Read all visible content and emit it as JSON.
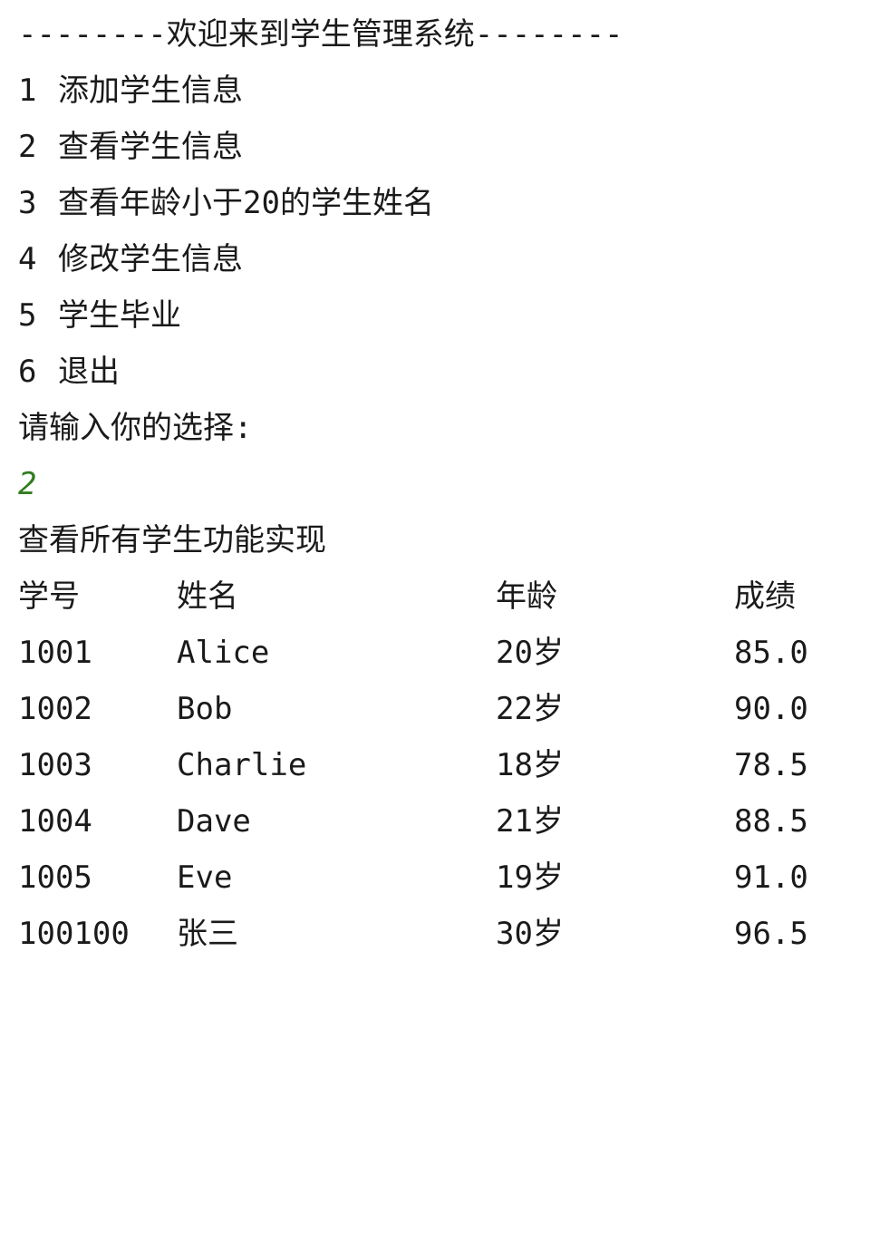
{
  "console": {
    "header": "--------欢迎来到学生管理系统--------",
    "menu": [
      {
        "num": "1",
        "label": "添加学生信息"
      },
      {
        "num": "2",
        "label": "查看学生信息"
      },
      {
        "num": "3",
        "label": "查看年龄小于20的学生姓名"
      },
      {
        "num": "4",
        "label": "修改学生信息"
      },
      {
        "num": "5",
        "label": "学生毕业"
      },
      {
        "num": "6",
        "label": "退出"
      }
    ],
    "prompt": "请输入你的选择:",
    "user_input": "2",
    "input_color": "#2f7d1e",
    "feature_title": "查看所有学生功能实现",
    "table": {
      "headers": [
        "学号",
        "姓名",
        "年龄",
        "成绩"
      ],
      "rows": [
        [
          "1001",
          "Alice",
          "20岁",
          "85.0"
        ],
        [
          "1002",
          "Bob",
          "22岁",
          "90.0"
        ],
        [
          "1003",
          "Charlie",
          "18岁",
          "78.5"
        ],
        [
          "1004",
          "Dave",
          "21岁",
          "88.5"
        ],
        [
          "1005",
          "Eve",
          "19岁",
          "91.0"
        ],
        [
          "100100",
          "张三",
          "30岁",
          "96.5"
        ]
      ]
    }
  }
}
